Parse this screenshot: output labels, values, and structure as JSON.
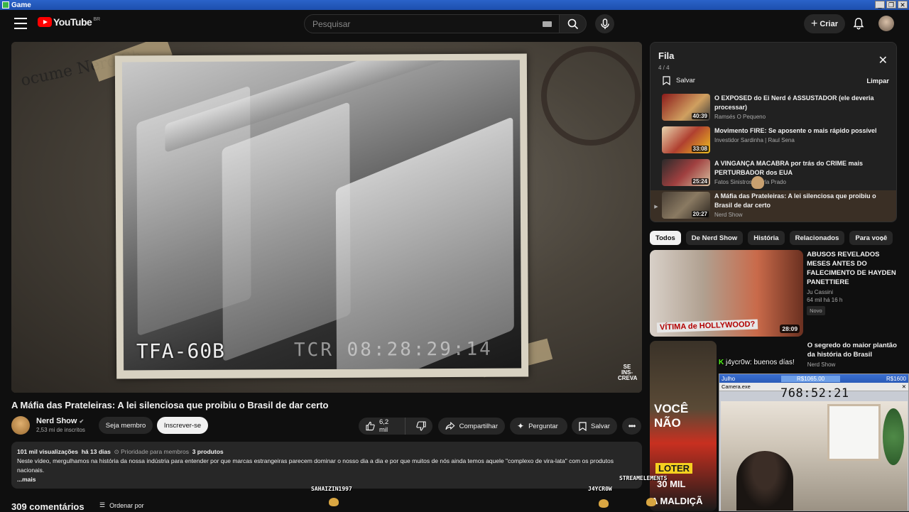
{
  "window": {
    "title": "Game",
    "controls": [
      "_",
      "❐",
      "✕"
    ]
  },
  "header": {
    "logo_text": "YouTube",
    "country": "BR",
    "search_placeholder": "Pesquisar",
    "create_label": "Criar"
  },
  "player": {
    "timecode_left": "TFA-60B",
    "timecode_right": "TCR 08:28:29:14",
    "watermark": "SE INS- CREVA",
    "doc_text": "ocume Nerd Sh"
  },
  "video": {
    "title": "A Máfia das Prateleiras: A lei silenciosa que proibiu o Brasil de dar certo",
    "channel": "Nerd Show",
    "subscribers": "2,53 mi de inscritos",
    "member_label": "Seja membro",
    "subscribe_label": "Inscrever-se",
    "likes": "6,2 mil",
    "share_label": "Compartilhar",
    "ask_label": "Perguntar",
    "save_label": "Salvar"
  },
  "description": {
    "views": "101 mil visualizações",
    "age": "há 13 dias",
    "priority": "Prioridade para membros",
    "products": "3 produtos",
    "text": "Neste vídeo, mergulhamos na história da nossa indústria para entender por que marcas estrangeiras parecem dominar o nosso dia a dia e por que muitos de nós ainda temos aquele \"complexo de vira-lata\" com os produtos nacionais.",
    "more": "...mais"
  },
  "comments": {
    "count_label": "309 comentários",
    "sort_label": "Ordenar por"
  },
  "queue": {
    "title": "Fila",
    "count": "4 / 4",
    "save_label": "Salvar",
    "clear_label": "Limpar",
    "items": [
      {
        "title": "O EXPOSED do Ei Nerd é ASSUSTADOR (ele deveria processar)",
        "channel": "Ramsés O Pequeno",
        "duration": "40:39",
        "marker": ""
      },
      {
        "title": "Movimento FIRE: Se aposente o mais rápido possível",
        "channel": "Investidor Sardinha | Raul Sena",
        "duration": "33:08",
        "marker": ""
      },
      {
        "title": "A VINGANÇA MACABRA por trás do CRIME mais PERTURBADOR dos EUA",
        "channel": "Fatos Sinistros - Mirla Prado",
        "duration": "25:24",
        "marker": ""
      },
      {
        "title": "A Máfia das Prateleiras: A lei silenciosa que proibiu o Brasil de dar certo",
        "channel": "Nerd Show",
        "duration": "20:27",
        "marker": "▶"
      }
    ]
  },
  "chips": [
    "Todos",
    "De Nerd Show",
    "História",
    "Relacionados",
    "Para você"
  ],
  "related": [
    {
      "title": "ABUSOS REVELADOS MESES ANTES DO FALECIMENTO DE HAYDEN PANETTIERE",
      "channel": "Ju Cassini",
      "meta": "64 mil  há 16 h",
      "badge": "Novo",
      "duration": "28:09",
      "thumb_label": "VÍTIMA de HOLLYWOOD?"
    },
    {
      "title": "O segredo do maior plantão da história do Brasil",
      "channel": "Nerd Show",
      "meta": "",
      "badge": "",
      "duration": "",
      "thumb_label": "VOCÊ NÃO"
    }
  ],
  "stream": {
    "chat_user": "j4ycr0w:",
    "chat_text": "buenos días!",
    "timer_owner": "Julho",
    "money_left": "R$1065.00",
    "money_right": "R$1600",
    "cam_app": "Camera.exe",
    "timer_value": "768:52:21",
    "name_left": "SAHAIZIN1997",
    "name_right": "J4YCR0W",
    "name_mid": "STREAMELEMENTS",
    "promo_1": "LOTER",
    "promo_2": "30 MIL",
    "promo_3": "A MALDIÇÃ"
  }
}
